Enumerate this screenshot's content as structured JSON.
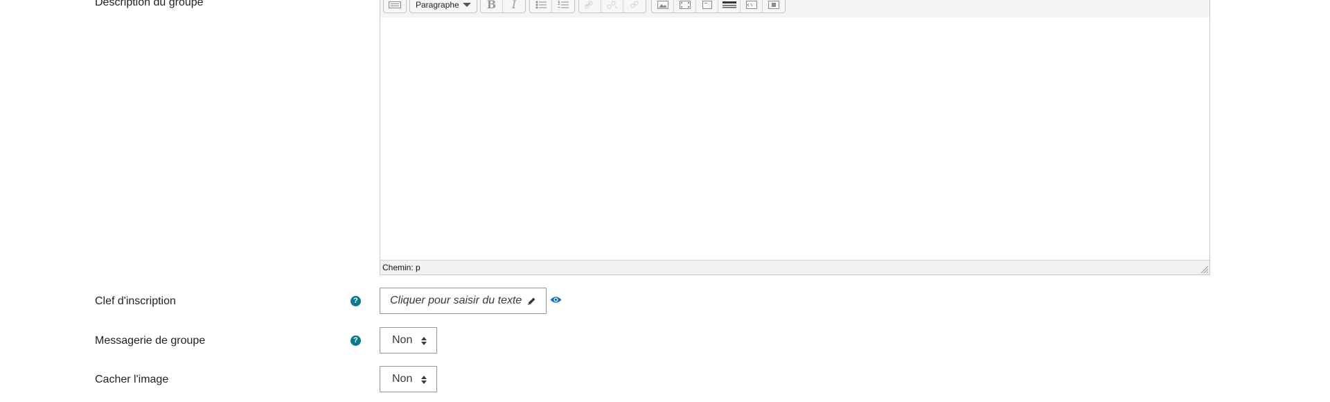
{
  "fields": {
    "description_label": "Description du groupe",
    "enrolment_key_label": "Clef d'inscription",
    "group_messaging_label": "Messagerie de groupe",
    "hide_picture_label": "Cacher l'image"
  },
  "editor": {
    "paragraph_select": "Paragraphe",
    "path_status": "Chemin: p",
    "toolbar_icons": [
      "keyboard-icon",
      "bold-icon",
      "italic-icon",
      "bullet-list-icon",
      "numbered-list-icon",
      "link-icon",
      "unlink-icon",
      "anchor-icon",
      "image-icon",
      "media-icon",
      "manage-files-icon",
      "special-char-icon",
      "html-icon",
      "record-video-icon"
    ]
  },
  "enrolment_key": {
    "value": "Cliquer pour saisir du texte"
  },
  "group_messaging": {
    "selected": "Non"
  },
  "hide_picture": {
    "selected": "Non"
  },
  "colors": {
    "help": "#0a7a8c",
    "eye": "#0f6cbf",
    "border": "#8f959e"
  }
}
